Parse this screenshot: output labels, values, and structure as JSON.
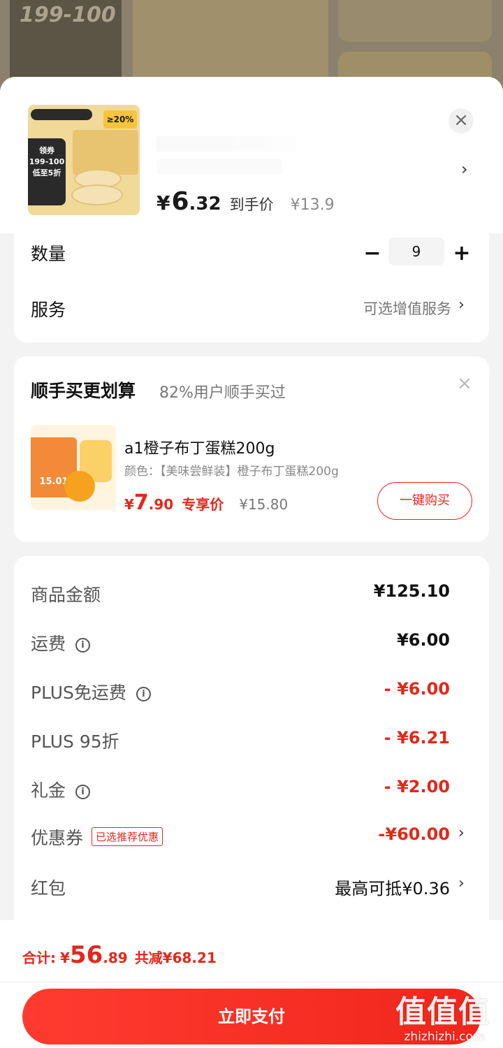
{
  "background_banner": {
    "tile1_text": "199-100"
  },
  "product": {
    "thumb": {
      "tag_text": "领券",
      "promo_line1": "199-100",
      "promo_line2": "低至5折",
      "badge_text": "≥20%"
    },
    "price_currency": "¥",
    "price_int": "6",
    "price_dec": ".32",
    "price_label": "到手价",
    "original_price": "¥13.9",
    "close_icon": "close-icon"
  },
  "quantity": {
    "label": "数量",
    "value": "9",
    "minus": "−",
    "plus": "+"
  },
  "service": {
    "label": "服务",
    "value": "可选增值服务"
  },
  "upsell": {
    "title": "顺手买更划算",
    "subtitle": "82%用户顺手买过",
    "item": {
      "name": "a1橙子布丁蛋糕200g",
      "spec": "颜色：【美味尝鲜装】橙子布丁蛋糕200g",
      "price_currency": "¥",
      "price_int": "7",
      "price_dec": ".90",
      "price_tag": "专享价",
      "original_price": "¥15.80",
      "thumb_price": "15.01"
    },
    "buy_button": "一键购买"
  },
  "summary": {
    "rows": [
      {
        "label": "商品金额",
        "value": "¥125.10",
        "info": false
      },
      {
        "label": "运费",
        "value": "¥6.00",
        "info": true
      },
      {
        "label": "PLUS免运费",
        "value": "- ¥6.00",
        "info": true
      },
      {
        "label": "PLUS 95折",
        "value": "- ¥6.21",
        "info": false
      },
      {
        "label": "礼金",
        "value": "- ¥2.00",
        "info": true
      },
      {
        "label": "优惠券",
        "value": "-¥60.00",
        "badge": "已选推荐优惠"
      },
      {
        "label": "红包",
        "value": "最高可抵¥0.36"
      }
    ]
  },
  "footer": {
    "total_label": "合计:",
    "total_currency": "¥",
    "total_int": "56",
    "total_dec": ".89",
    "saved": "共减¥68.21",
    "pay_button": "立即支付"
  },
  "watermark": {
    "big": "值值值",
    "small": "zhizhizhi.com"
  },
  "colors": {
    "accent_red": "#e2281c",
    "pay_gradient_start": "#ff3b30",
    "pay_gradient_end": "#f0261b"
  }
}
